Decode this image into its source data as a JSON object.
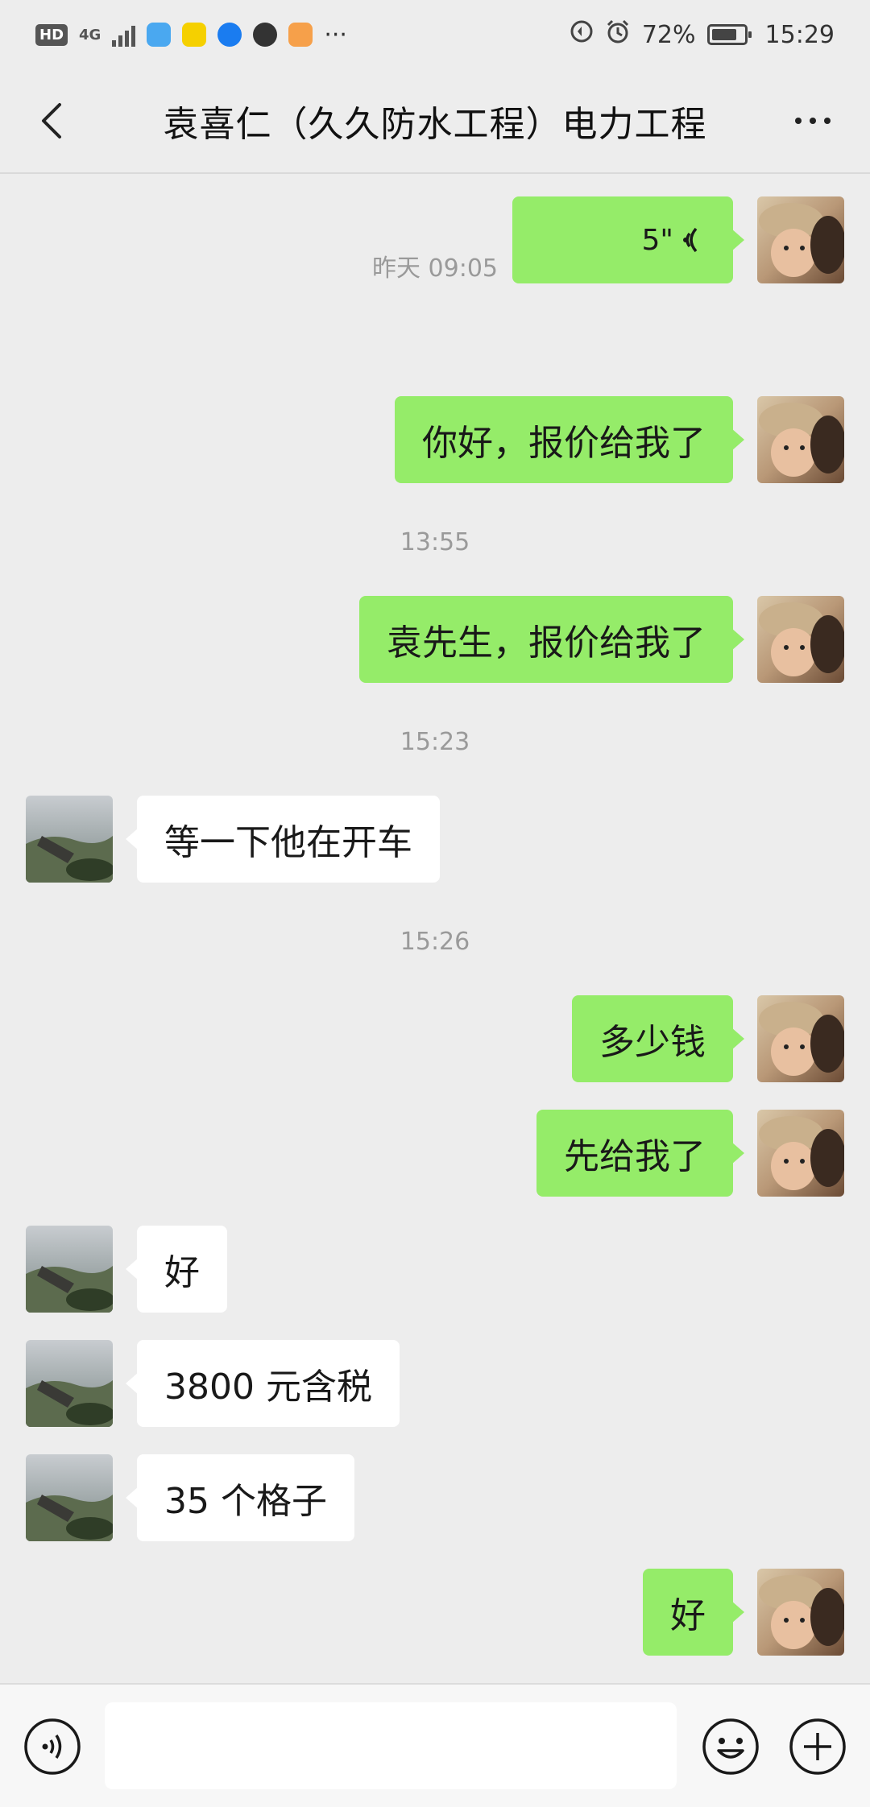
{
  "status_bar": {
    "hd_label": "HD",
    "network_label": "4G",
    "battery_percent": "72%",
    "time": "15:29",
    "overflow_dots": "···"
  },
  "header": {
    "title": "袁喜仁（久久防水工程）电力工程"
  },
  "messages": [
    {
      "type": "voice",
      "from": "me",
      "duration": "5\""
    },
    {
      "type": "time",
      "text": "昨天 09:05"
    },
    {
      "type": "text",
      "from": "me",
      "text": "你好，报价给我了"
    },
    {
      "type": "time",
      "text": "13:55"
    },
    {
      "type": "text",
      "from": "me",
      "text": "袁先生，报价给我了"
    },
    {
      "type": "time",
      "text": "15:23"
    },
    {
      "type": "text",
      "from": "them",
      "text": "等一下他在开车"
    },
    {
      "type": "time",
      "text": "15:26"
    },
    {
      "type": "text",
      "from": "me",
      "text": "多少钱"
    },
    {
      "type": "text",
      "from": "me",
      "text": "先给我了"
    },
    {
      "type": "text",
      "from": "them",
      "text": "好"
    },
    {
      "type": "text",
      "from": "them",
      "text": "3800 元含税"
    },
    {
      "type": "text",
      "from": "them",
      "text": "35 个格子"
    },
    {
      "type": "text",
      "from": "me",
      "text": "好"
    }
  ],
  "input_bar": {
    "value": "",
    "placeholder": ""
  },
  "colors": {
    "background": "#ededed",
    "my_bubble": "#95ec69",
    "their_bubble": "#ffffff",
    "timestamp_text": "#9a9a9a"
  }
}
